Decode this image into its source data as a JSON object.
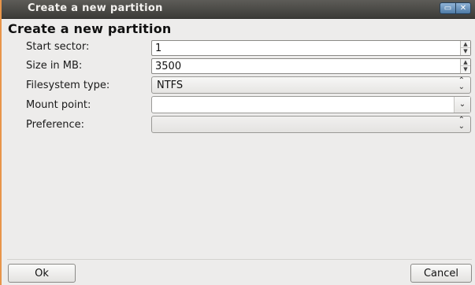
{
  "window": {
    "title": "Create a new partition",
    "minimize_glyph": "▭",
    "close_glyph": "✕"
  },
  "dialog": {
    "heading": "Create a new partition"
  },
  "form": {
    "start_sector": {
      "label": "Start sector:",
      "value": "1"
    },
    "size_mb": {
      "label": "Size in MB:",
      "value": "3500"
    },
    "filesystem_type": {
      "label": "Filesystem type:",
      "value": "NTFS"
    },
    "mount_point": {
      "label": "Mount point:",
      "value": ""
    },
    "preference": {
      "label": "Preference:",
      "value": ""
    }
  },
  "glyphs": {
    "spin_up": "▲",
    "spin_down": "▼",
    "combo_updown": "⌃⌄",
    "dropdown": "⌄"
  },
  "buttons": {
    "ok": "Ok",
    "cancel": "Cancel"
  },
  "colors": {
    "desktop_bg": "#e8954a",
    "titlebar": "#4b4a46",
    "dialog_bg": "#edeceb",
    "window_buttons": "#4f7ba6"
  }
}
